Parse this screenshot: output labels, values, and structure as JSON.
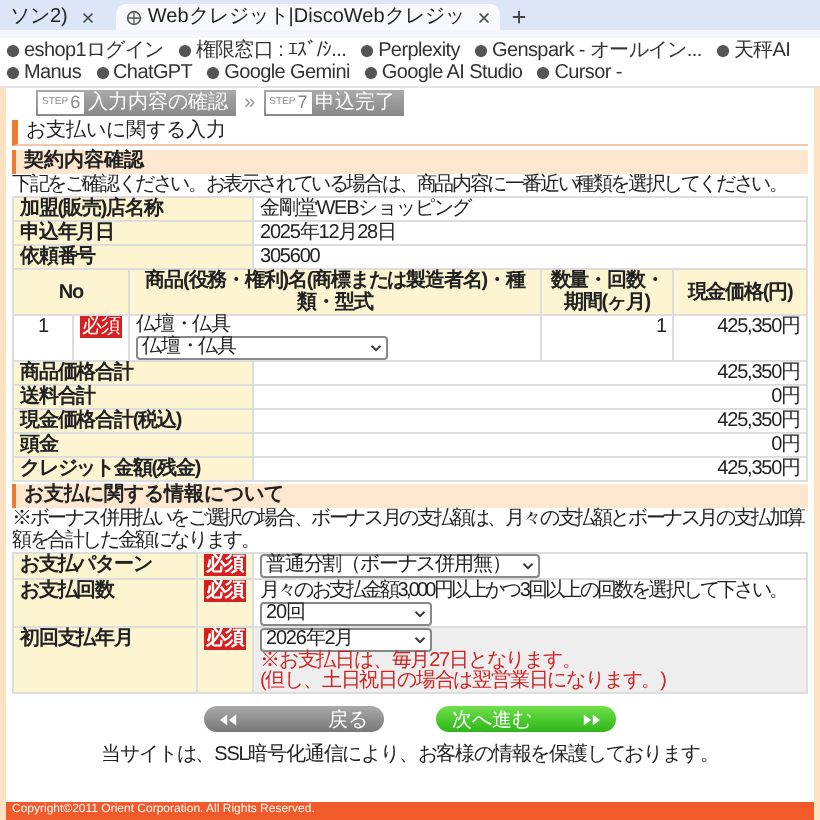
{
  "browser": {
    "tabs": [
      {
        "title": "ソン2)",
        "selected": false
      },
      {
        "title": "Webクレジット|DiscoWebクレジッ",
        "selected": true
      }
    ],
    "bookmarks": [
      "eshop1ログイン",
      "権限窓口 : ｴｽﾞ/ｼ...",
      "Perplexity",
      "Genspark - オールイン...",
      "天秤AI",
      "Manus",
      "ChatGPT",
      "Google Gemini",
      "Google AI Studio",
      "Cursor -"
    ]
  },
  "steps": [
    {
      "tag": "STEP",
      "number": "6",
      "title": "入力内容の確認"
    },
    {
      "tag": "STEP",
      "number": "7",
      "title": "申込完了"
    }
  ],
  "step_separator": "»",
  "page_title": "お支払いに関する入力",
  "contract": {
    "title": "契約内容確認",
    "note": "下記をご確認ください。お表示されている場合は、商品内容に一番近い種類を選択してください。",
    "rows": [
      {
        "label": "加盟(販売)店名称",
        "value": "金剛堂WEBショッピング"
      },
      {
        "label": "申込年月日",
        "value": "2025年12月28日"
      },
      {
        "label": "依頼番号",
        "value": "305600"
      }
    ],
    "columns": [
      "No",
      "商品(役務・権利)名(商標または製造者名)・種類・型式",
      "数量・回数・期間(ヶ月)",
      "現金価格(円)"
    ],
    "items": [
      {
        "no": "1",
        "badge": "必須",
        "category": "仏壇・仏具",
        "selection": "仏壇・仏具",
        "quantity": "1",
        "price": "425,350円"
      }
    ],
    "totals": [
      {
        "label": "商品価格合計",
        "value": "425,350円"
      },
      {
        "label": "送料合計",
        "value": "0円"
      },
      {
        "label": "現金価格合計(税込)",
        "value": "425,350円"
      },
      {
        "label": "頭金",
        "value": "0円"
      },
      {
        "label": "クレジット金額(残金)",
        "value": "425,350円"
      }
    ]
  },
  "payment": {
    "title": "お支払に関する情報について",
    "note": "※ボーナス併用払いをご選択の場合、ボーナス月の支払額は、月々の支払額とボーナス月の支払加算額を合計した金額になります。",
    "rows": [
      {
        "label": "お支払パターン",
        "badge": "必須",
        "selection": "普通分割（ボーナス併用無）"
      },
      {
        "label": "お支払回数",
        "badge": "必須",
        "hint": "月々のお支払金額3,000円以上かつ3回以上の回数を選択して下さい。",
        "selection": "20回"
      },
      {
        "label": "初回支払年月",
        "badge": "必須",
        "selection": "2026年2月",
        "notes": [
          "※お支払日は、毎月27日となります。",
          "(但し、土日祝日の場合は翌営業日になります。)"
        ]
      }
    ]
  },
  "buttons": [
    {
      "label": "戻る",
      "kind": "back"
    },
    {
      "label": "次へ進む",
      "kind": "next"
    }
  ],
  "ssl_note": "当サイトは、SSL暗号化通信により、お客様の情報を保護しております。",
  "copyright": "Copyright©2011 Orient Corporation. All Rights Reserved."
}
